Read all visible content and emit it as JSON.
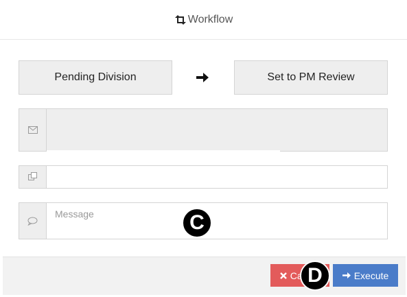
{
  "header": {
    "title": "Workflow",
    "icon": "retweet-icon"
  },
  "transition": {
    "from_state": "Pending Division",
    "to_state": "Set to PM Review",
    "arrow_icon": "arrow-right-icon"
  },
  "form": {
    "email": {
      "icon": "envelope-icon",
      "value": ""
    },
    "copy": {
      "icon": "copy-icon",
      "value": ""
    },
    "message": {
      "icon": "comment-icon",
      "placeholder": "Message",
      "value": ""
    }
  },
  "footer": {
    "cancel_label": "Cancel",
    "cancel_icon": "times-icon",
    "execute_label": "Execute",
    "execute_icon": "arrow-right-icon"
  },
  "markers": {
    "c": "C",
    "d": "D"
  },
  "colors": {
    "cancel": "#e35b5b",
    "execute": "#4a7cc9",
    "addon_bg": "#eeeeee"
  }
}
